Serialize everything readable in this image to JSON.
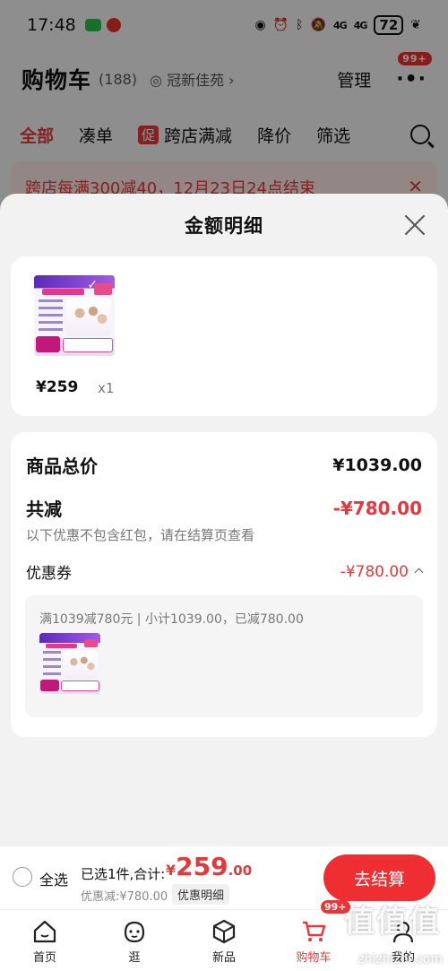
{
  "status_bar": {
    "time": "17:48",
    "network": "4G",
    "network2": "4G",
    "battery": "72"
  },
  "cart_header": {
    "title": "购物车",
    "count": "(188)",
    "location": "冠新佳苑 ›",
    "manage": "管理",
    "more_badge": "99+"
  },
  "cart_tabs": [
    {
      "label": "全部",
      "active": true
    },
    {
      "label": "凑单",
      "active": false
    },
    {
      "label": "跨店满减",
      "tag": "促",
      "active": false
    },
    {
      "label": "降价",
      "active": false
    },
    {
      "label": "筛选",
      "active": false
    }
  ],
  "promo_banner": {
    "text": "跨店每满300减40，12月23日24点结束"
  },
  "sheet": {
    "title": "金额明细",
    "product": {
      "price": "¥259",
      "qty": "x1"
    },
    "summary": {
      "total_label": "商品总价",
      "total_value": "¥1039.00",
      "reduce_label": "共减",
      "reduce_value": "-¥780.00",
      "note": "以下优惠不包含红包，请在结算页查看",
      "coupon_label": "优惠券",
      "coupon_value": "-¥780.00",
      "coupon_desc": "满1039减780元 | 小计1039.00，已减780.00"
    }
  },
  "checkout": {
    "select_all": "全选",
    "selected_info": "已选1件,合计:",
    "yen": "¥",
    "total_int": "259",
    "total_dec": ".00",
    "discount_line": "优惠减:¥780.00",
    "detail_chip": "优惠明细",
    "button": "去结算"
  },
  "tabbar": {
    "items": [
      {
        "label": "首页",
        "icon": "home-icon"
      },
      {
        "label": "逛",
        "icon": "face-icon"
      },
      {
        "label": "新品",
        "icon": "box-icon"
      },
      {
        "label": "购物车",
        "icon": "cart-icon"
      },
      {
        "label": "我的",
        "icon": "user-icon"
      }
    ],
    "cart_badge": "99+"
  },
  "watermark": {
    "text": "值值值",
    "url": "zhizhizhi.com"
  },
  "colors": {
    "accent": "#e4393c",
    "button": "#ee2e30",
    "dim_overlay": "rgba(0,0,0,0.42)"
  }
}
